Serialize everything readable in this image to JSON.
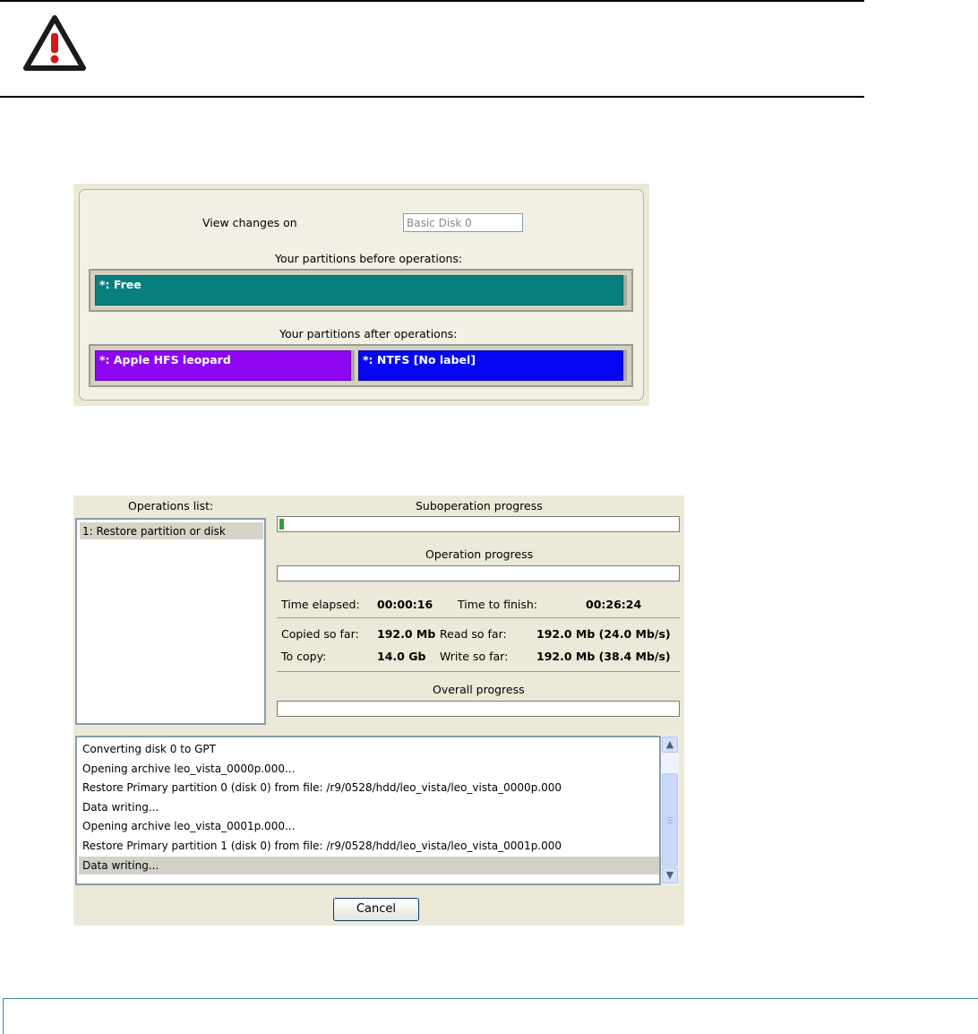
{
  "panel_partitions": {
    "view_changes_label": "View changes on",
    "disk_value": "Basic Disk 0",
    "before_label": "Your partitions before operations:",
    "after_label": "Your partitions after operations:",
    "before_partitions": [
      {
        "label": "*: Free",
        "color": "#087f7f"
      }
    ],
    "after_partitions": [
      {
        "label": "*: Apple HFS leopard",
        "color": "#8e06f2"
      },
      {
        "label": "*: NTFS [No label]",
        "color": "#0606f3"
      }
    ]
  },
  "progress_window": {
    "operations_list_label": "Operations list:",
    "operations": [
      "1: Restore partition or disk"
    ],
    "suboperation_label": "Suboperation progress",
    "suboperation_progress": 0.01,
    "operation_label": "Operation progress",
    "operation_progress": 0,
    "time_elapsed_label": "Time elapsed:",
    "time_elapsed": "00:00:16",
    "time_to_finish_label": "Time to finish:",
    "time_to_finish": "00:26:24",
    "copied_label": "Copied so far:",
    "copied": "192.0 Mb",
    "read_label": "Read so far:",
    "read": "192.0 Mb (24.0 Mb/s)",
    "to_copy_label": "To copy:",
    "to_copy": "14.0 Gb",
    "write_label": "Write so far:",
    "write": "192.0 Mb (38.4 Mb/s)",
    "overall_label": "Overall progress",
    "overall_progress": 0,
    "log": [
      "Converting disk 0 to GPT",
      "Opening archive leo_vista_0000p.000...",
      "Restore Primary partition 0 (disk 0) from file: /r9/0528/hdd/leo_vista/leo_vista_0000p.000",
      "Data writing...",
      "Opening archive leo_vista_0001p.000...",
      "Restore Primary partition 1 (disk 0) from file: /r9/0528/hdd/leo_vista/leo_vista_0001p.000",
      "Data writing..."
    ],
    "cancel_label": "Cancel"
  },
  "colors": {
    "warning_red": "#d7141b",
    "panel_bg": "#ece9d8",
    "progress_green": "#3a9a3a"
  }
}
